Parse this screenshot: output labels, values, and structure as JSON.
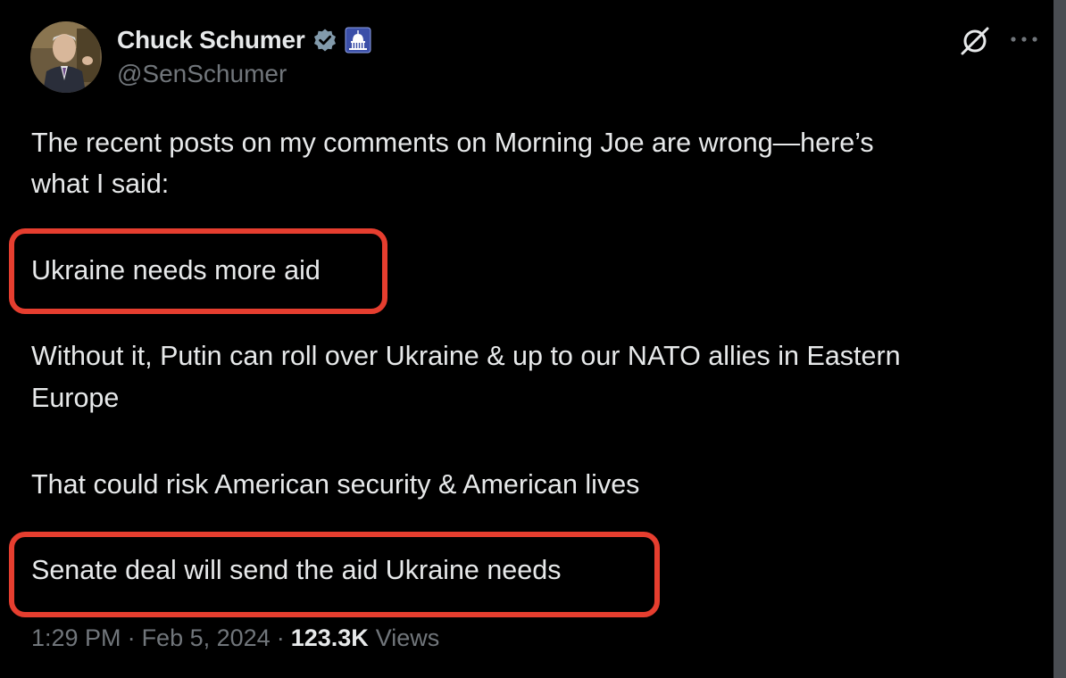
{
  "author": {
    "display_name": "Chuck Schumer",
    "handle": "@SenSchumer",
    "verified_icon": "verified-badge-icon",
    "affiliation_icon": "capitol-badge-icon",
    "avatar": "profile-photo"
  },
  "actions": {
    "grok_icon": "grok-icon",
    "more_icon": "more-options-icon"
  },
  "tweet": {
    "line1": "The recent posts on my comments on Morning Joe are wrong—here’s",
    "line2": "what I said:",
    "highlight1": "Ukraine needs more aid",
    "line3": "Without it, Putin can roll over Ukraine & up to our NATO allies in Eastern",
    "line4": "Europe",
    "line5": "That could risk American security & American lives",
    "highlight2": "Senate deal will send the aid Ukraine needs"
  },
  "meta": {
    "time": "1:29 PM",
    "separator": "·",
    "date": "Feb 5, 2024",
    "views_count": "123.3K",
    "views_label": "Views"
  },
  "colors": {
    "background": "#000000",
    "text": "#e7e9ea",
    "muted": "#71767b",
    "highlight_border": "#e63e2f",
    "verified": "#829aab"
  }
}
